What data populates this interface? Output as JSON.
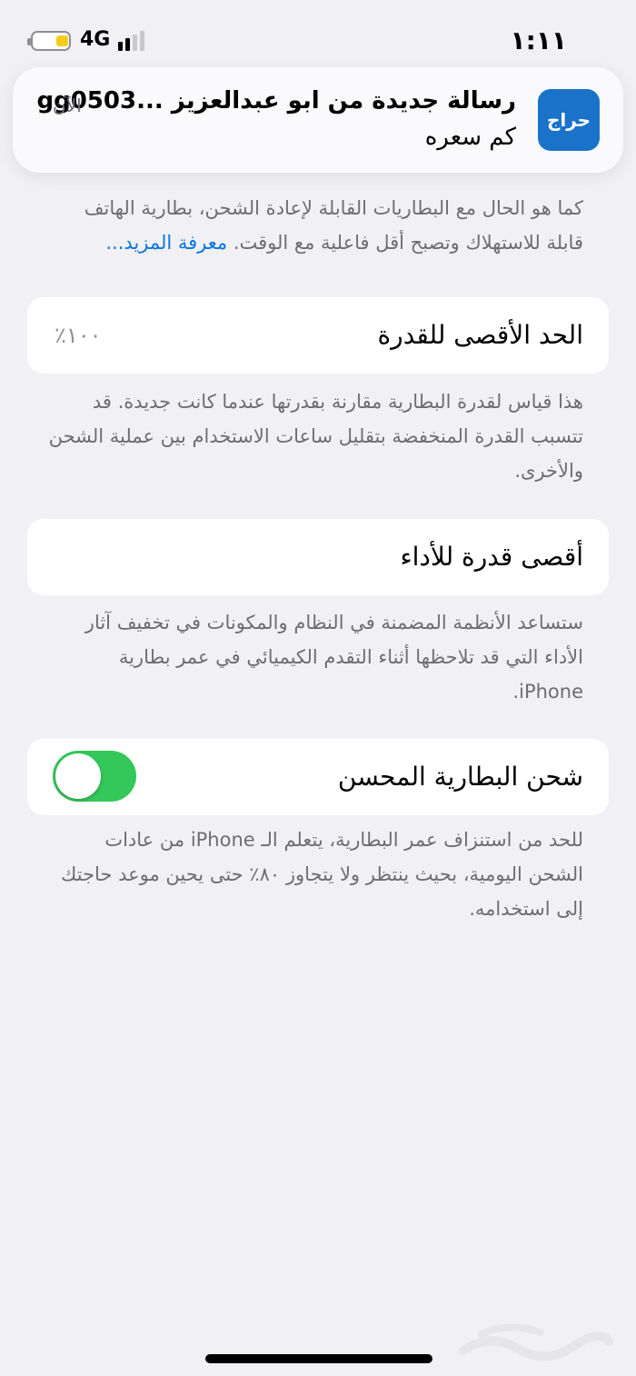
{
  "status_bar": {
    "time": "١:١١",
    "network": "4G",
    "battery_level": 0.35
  },
  "notification": {
    "app_icon_label": "حراج",
    "title": "رسالة جديدة من ابو عبدالعزيز ...gg0503",
    "body": "كم سعره",
    "time": "الآن"
  },
  "intro": {
    "text": "كما هو الحال مع البطاريات القابلة لإعادة الشحن، بطارية الهاتف قابلة للاستهلاك وتصبح أقل فاعلية مع الوقت.",
    "link": "معرفة المزيد..."
  },
  "max_capacity": {
    "label": "الحد الأقصى للقدرة",
    "value": "٪١٠٠",
    "description": "هذا قياس لقدرة البطارية مقارنة بقدرتها عندما كانت جديدة. قد تتسبب القدرة المنخفضة بتقليل ساعات الاستخدام بين عملية الشحن والأخرى."
  },
  "peak_performance": {
    "label": "أقصى قدرة للأداء",
    "description": "ستساعد الأنظمة المضمنة في النظام والمكونات في تخفيف آثار الأداء التي قد تلاحظها أثناء التقدم الكيميائي في عمر بطارية iPhone."
  },
  "optimized_charging": {
    "label": "شحن البطارية المحسن",
    "enabled": true,
    "description": "للحد من استنزاف عمر البطارية، يتعلم الـ iPhone من عادات الشحن اليومية، بحيث ينتظر ولا يتجاوز ٨٠٪ حتى يحين موعد حاجتك إلى استخدامه."
  },
  "colors": {
    "toggle_on": "#34c759",
    "link": "#0a74e2",
    "app_icon": "#1a73c8",
    "battery_fill": "#f5cc1b"
  }
}
